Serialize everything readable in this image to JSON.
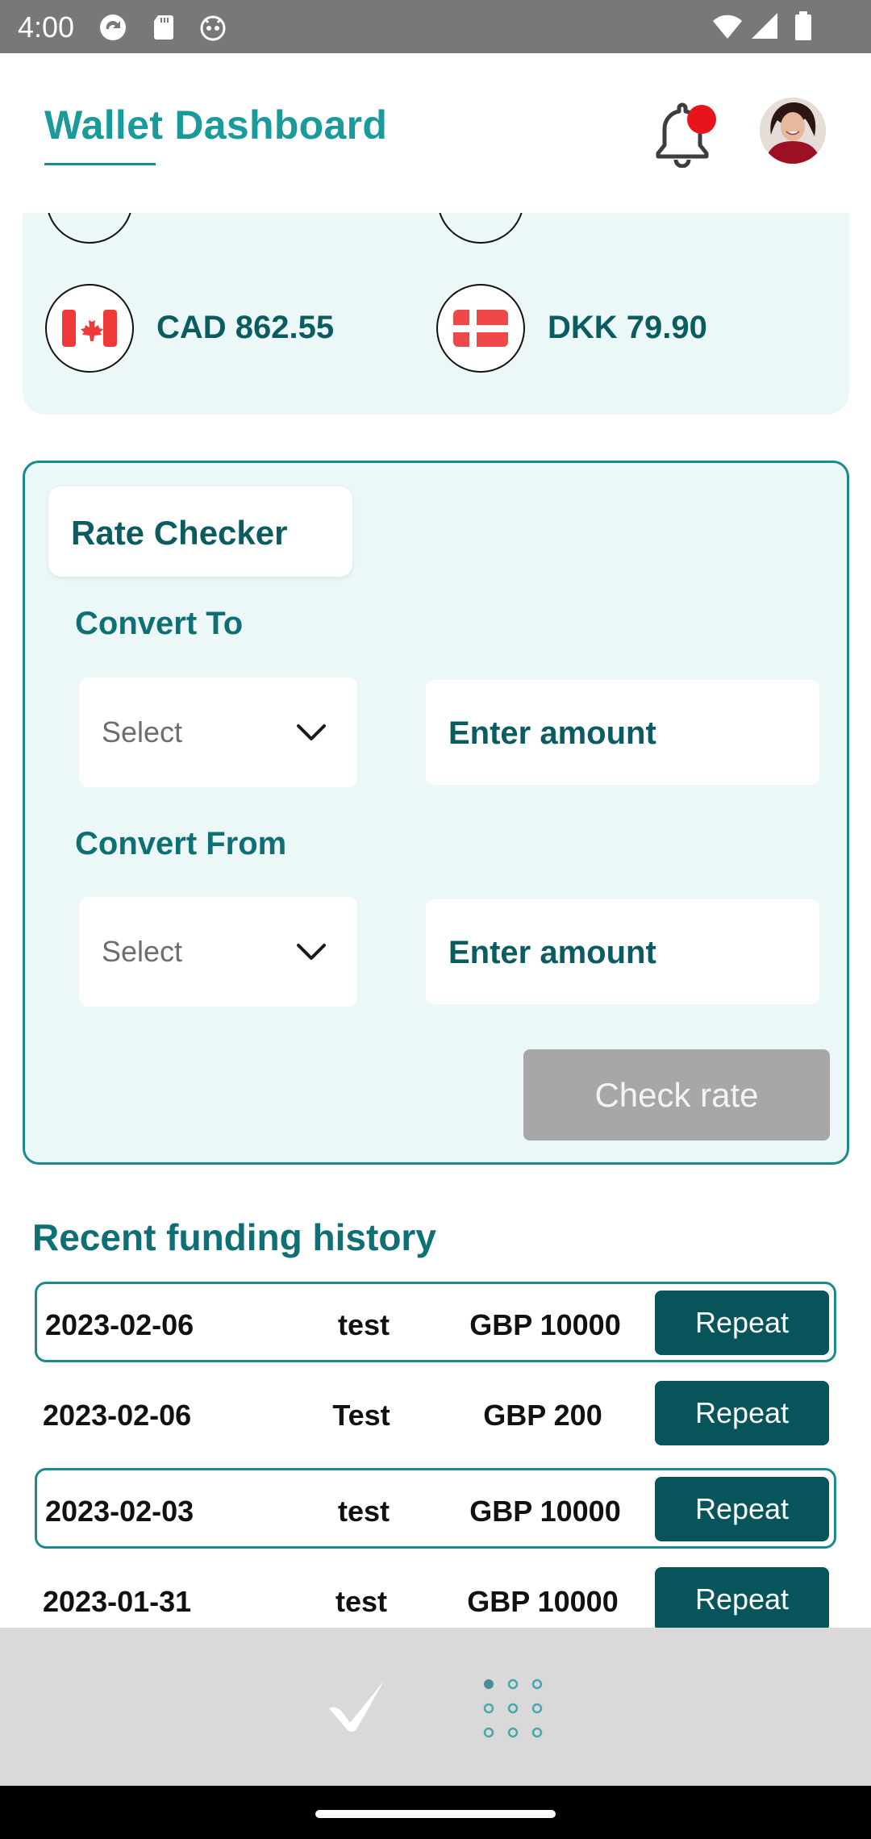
{
  "status_bar": {
    "time": "4:00"
  },
  "header": {
    "title": "Wallet Dashboard",
    "has_notification": true
  },
  "balances": [
    {
      "currency_flag": "canada-flag-icon",
      "label": "CAD 862.55"
    },
    {
      "currency_flag": "denmark-flag-icon",
      "label": "DKK 79.90"
    }
  ],
  "rate_checker": {
    "tab_label": "Rate Checker",
    "convert_to": {
      "label": "Convert To",
      "select_value": "Select",
      "amount_placeholder": "Enter amount"
    },
    "convert_from": {
      "label": "Convert From",
      "select_value": "Select",
      "amount_placeholder": "Enter amount"
    },
    "check_button": "Check rate"
  },
  "history": {
    "title": "Recent funding history",
    "repeat_label": "Repeat",
    "rows": [
      {
        "date": "2023-02-06",
        "name": "test",
        "amount": "GBP 10000"
      },
      {
        "date": "2023-02-06",
        "name": "Test",
        "amount": "GBP 200"
      },
      {
        "date": "2023-02-03",
        "name": "test",
        "amount": "GBP 10000"
      },
      {
        "date": "2023-01-31",
        "name": "test",
        "amount": "GBP 10000"
      }
    ]
  },
  "bottom_nav": {
    "items": [
      "logo-icon",
      "apps-grid-icon"
    ]
  },
  "colors": {
    "primary": "#07545a",
    "accent": "#1a9b9b",
    "panel_bg": "#ecf8f8",
    "disabled_button": "#a7a7a7",
    "notification_dot": "#e8141b"
  }
}
